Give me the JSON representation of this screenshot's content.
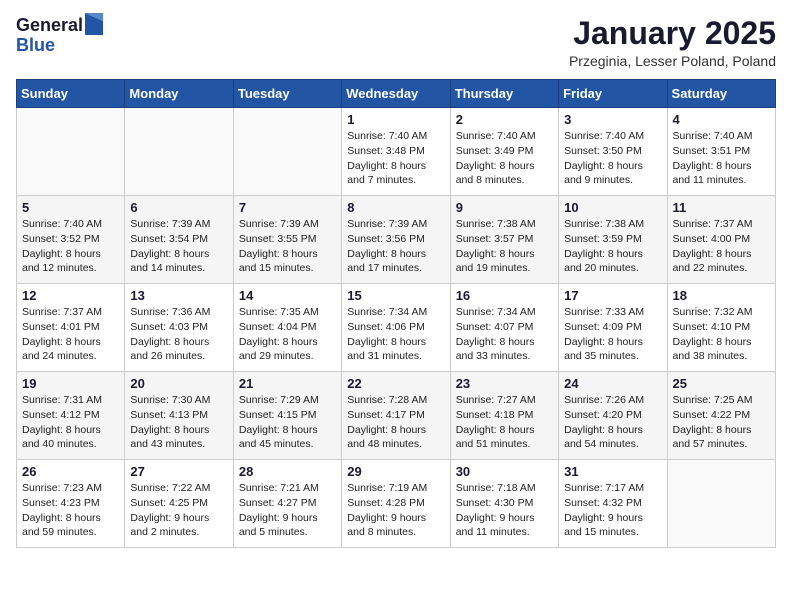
{
  "logo": {
    "general": "General",
    "blue": "Blue"
  },
  "header": {
    "month": "January 2025",
    "location": "Przeginia, Lesser Poland, Poland"
  },
  "weekdays": [
    "Sunday",
    "Monday",
    "Tuesday",
    "Wednesday",
    "Thursday",
    "Friday",
    "Saturday"
  ],
  "weeks": [
    [
      {
        "day": "",
        "info": ""
      },
      {
        "day": "",
        "info": ""
      },
      {
        "day": "",
        "info": ""
      },
      {
        "day": "1",
        "info": "Sunrise: 7:40 AM\nSunset: 3:48 PM\nDaylight: 8 hours\nand 7 minutes."
      },
      {
        "day": "2",
        "info": "Sunrise: 7:40 AM\nSunset: 3:49 PM\nDaylight: 8 hours\nand 8 minutes."
      },
      {
        "day": "3",
        "info": "Sunrise: 7:40 AM\nSunset: 3:50 PM\nDaylight: 8 hours\nand 9 minutes."
      },
      {
        "day": "4",
        "info": "Sunrise: 7:40 AM\nSunset: 3:51 PM\nDaylight: 8 hours\nand 11 minutes."
      }
    ],
    [
      {
        "day": "5",
        "info": "Sunrise: 7:40 AM\nSunset: 3:52 PM\nDaylight: 8 hours\nand 12 minutes."
      },
      {
        "day": "6",
        "info": "Sunrise: 7:39 AM\nSunset: 3:54 PM\nDaylight: 8 hours\nand 14 minutes."
      },
      {
        "day": "7",
        "info": "Sunrise: 7:39 AM\nSunset: 3:55 PM\nDaylight: 8 hours\nand 15 minutes."
      },
      {
        "day": "8",
        "info": "Sunrise: 7:39 AM\nSunset: 3:56 PM\nDaylight: 8 hours\nand 17 minutes."
      },
      {
        "day": "9",
        "info": "Sunrise: 7:38 AM\nSunset: 3:57 PM\nDaylight: 8 hours\nand 19 minutes."
      },
      {
        "day": "10",
        "info": "Sunrise: 7:38 AM\nSunset: 3:59 PM\nDaylight: 8 hours\nand 20 minutes."
      },
      {
        "day": "11",
        "info": "Sunrise: 7:37 AM\nSunset: 4:00 PM\nDaylight: 8 hours\nand 22 minutes."
      }
    ],
    [
      {
        "day": "12",
        "info": "Sunrise: 7:37 AM\nSunset: 4:01 PM\nDaylight: 8 hours\nand 24 minutes."
      },
      {
        "day": "13",
        "info": "Sunrise: 7:36 AM\nSunset: 4:03 PM\nDaylight: 8 hours\nand 26 minutes."
      },
      {
        "day": "14",
        "info": "Sunrise: 7:35 AM\nSunset: 4:04 PM\nDaylight: 8 hours\nand 29 minutes."
      },
      {
        "day": "15",
        "info": "Sunrise: 7:34 AM\nSunset: 4:06 PM\nDaylight: 8 hours\nand 31 minutes."
      },
      {
        "day": "16",
        "info": "Sunrise: 7:34 AM\nSunset: 4:07 PM\nDaylight: 8 hours\nand 33 minutes."
      },
      {
        "day": "17",
        "info": "Sunrise: 7:33 AM\nSunset: 4:09 PM\nDaylight: 8 hours\nand 35 minutes."
      },
      {
        "day": "18",
        "info": "Sunrise: 7:32 AM\nSunset: 4:10 PM\nDaylight: 8 hours\nand 38 minutes."
      }
    ],
    [
      {
        "day": "19",
        "info": "Sunrise: 7:31 AM\nSunset: 4:12 PM\nDaylight: 8 hours\nand 40 minutes."
      },
      {
        "day": "20",
        "info": "Sunrise: 7:30 AM\nSunset: 4:13 PM\nDaylight: 8 hours\nand 43 minutes."
      },
      {
        "day": "21",
        "info": "Sunrise: 7:29 AM\nSunset: 4:15 PM\nDaylight: 8 hours\nand 45 minutes."
      },
      {
        "day": "22",
        "info": "Sunrise: 7:28 AM\nSunset: 4:17 PM\nDaylight: 8 hours\nand 48 minutes."
      },
      {
        "day": "23",
        "info": "Sunrise: 7:27 AM\nSunset: 4:18 PM\nDaylight: 8 hours\nand 51 minutes."
      },
      {
        "day": "24",
        "info": "Sunrise: 7:26 AM\nSunset: 4:20 PM\nDaylight: 8 hours\nand 54 minutes."
      },
      {
        "day": "25",
        "info": "Sunrise: 7:25 AM\nSunset: 4:22 PM\nDaylight: 8 hours\nand 57 minutes."
      }
    ],
    [
      {
        "day": "26",
        "info": "Sunrise: 7:23 AM\nSunset: 4:23 PM\nDaylight: 8 hours\nand 59 minutes."
      },
      {
        "day": "27",
        "info": "Sunrise: 7:22 AM\nSunset: 4:25 PM\nDaylight: 9 hours\nand 2 minutes."
      },
      {
        "day": "28",
        "info": "Sunrise: 7:21 AM\nSunset: 4:27 PM\nDaylight: 9 hours\nand 5 minutes."
      },
      {
        "day": "29",
        "info": "Sunrise: 7:19 AM\nSunset: 4:28 PM\nDaylight: 9 hours\nand 8 minutes."
      },
      {
        "day": "30",
        "info": "Sunrise: 7:18 AM\nSunset: 4:30 PM\nDaylight: 9 hours\nand 11 minutes."
      },
      {
        "day": "31",
        "info": "Sunrise: 7:17 AM\nSunset: 4:32 PM\nDaylight: 9 hours\nand 15 minutes."
      },
      {
        "day": "",
        "info": ""
      }
    ]
  ]
}
